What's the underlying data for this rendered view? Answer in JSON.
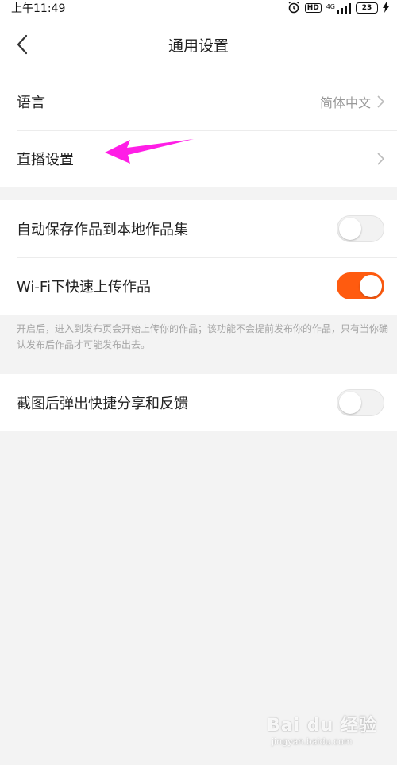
{
  "status_bar": {
    "time": "上午11:49",
    "hd": "HD",
    "network": "4G",
    "battery": "23"
  },
  "header": {
    "title": "通用设置"
  },
  "settings": {
    "language": {
      "label": "语言",
      "value": "简体中文"
    },
    "live": {
      "label": "直播设置"
    },
    "auto_save": {
      "label": "自动保存作品到本地作品集",
      "enabled": false
    },
    "wifi_upload": {
      "label": "Wi-Fi下快速上传作品",
      "enabled": true
    },
    "wifi_hint": "开启后，进入到发布页会开始上传你的作品；该功能不会提前发布你的作品，只有当你确认发布后作品才可能发布出去。",
    "screenshot_share": {
      "label": "截图后弹出快捷分享和反馈",
      "enabled": false
    }
  },
  "colors": {
    "accent": "#ff5b0f",
    "annotation_arrow": "#ff1ee6"
  },
  "watermark": {
    "logo": "Bai du 经验",
    "url": "jingyan.baidu.com"
  }
}
